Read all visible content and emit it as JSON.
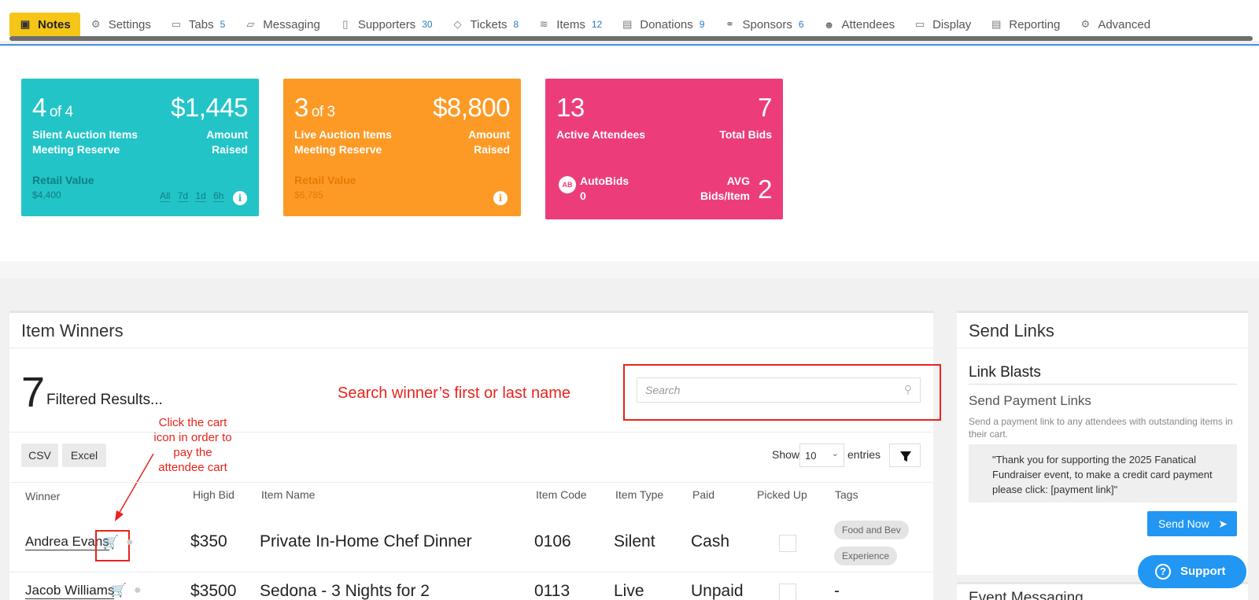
{
  "tabs": [
    {
      "label": "Notes",
      "icon": "notes-icon",
      "glyph": "▣",
      "count": ""
    },
    {
      "label": "Settings",
      "icon": "gear-icon",
      "glyph": "⚙",
      "count": ""
    },
    {
      "label": "Tabs",
      "icon": "folder-icon",
      "glyph": "▭",
      "count": "5"
    },
    {
      "label": "Messaging",
      "icon": "inbox-icon",
      "glyph": "▱",
      "count": ""
    },
    {
      "label": "Supporters",
      "icon": "clipboard-icon",
      "glyph": "▯",
      "count": "30"
    },
    {
      "label": "Tickets",
      "icon": "tag-icon",
      "glyph": "◇",
      "count": "8"
    },
    {
      "label": "Items",
      "icon": "layers-icon",
      "glyph": "≋",
      "count": "12"
    },
    {
      "label": "Donations",
      "icon": "receipt-icon",
      "glyph": "▤",
      "count": "9"
    },
    {
      "label": "Sponsors",
      "icon": "handshake-icon",
      "glyph": "⚭",
      "count": "6"
    },
    {
      "label": "Attendees",
      "icon": "users-icon",
      "glyph": "☻",
      "count": ""
    },
    {
      "label": "Display",
      "icon": "monitor-icon",
      "glyph": "▭",
      "count": ""
    },
    {
      "label": "Reporting",
      "icon": "file-chart-icon",
      "glyph": "▤",
      "count": ""
    },
    {
      "label": "Advanced",
      "icon": "gears-icon",
      "glyph": "⚙",
      "count": ""
    }
  ],
  "cards": {
    "silent": {
      "count": "4",
      "of": "of 4",
      "amount": "$1,445",
      "label1": "Silent Auction Items",
      "label2": "Meeting Reserve",
      "amount_label1": "Amount",
      "amount_label2": "Raised",
      "retail_label": "Retail Value",
      "retail_value": "$4,400",
      "time_filters": [
        "All",
        "7d",
        "1d",
        "6h"
      ],
      "color": "#22c4c8",
      "subcolor": "#0f7f82"
    },
    "live": {
      "count": "3",
      "of": "of 3",
      "amount": "$8,800",
      "label1": "Live Auction Items",
      "label2": "Meeting Reserve",
      "amount_label1": "Amount",
      "amount_label2": "Raised",
      "retail_label": "Retail Value",
      "retail_value": "$6,785",
      "color": "#fd9a26",
      "subcolor": "#e67a00"
    },
    "attendees": {
      "count": "13",
      "count_label": "Active Attendees",
      "bids": "7",
      "bids_label": "Total Bids",
      "autobids_label": "AutoBids",
      "autobids_value": "0",
      "avg_label1": "AVG",
      "avg_label2": "Bids/Item",
      "avg_value": "2",
      "color": "#ec3d7a"
    }
  },
  "winners": {
    "title": "Item Winners",
    "count": "7",
    "count_label": "Filtered Results...",
    "search_placeholder": "Search",
    "csv_label": "CSV",
    "excel_label": "Excel",
    "show_label": "Show",
    "entries_value": "10",
    "entries_label": "entries",
    "columns": [
      "Winner",
      "High Bid",
      "Item Name",
      "Item Code",
      "Item Type",
      "Paid",
      "Picked Up",
      "Tags"
    ],
    "rows": [
      {
        "winner": "Andrea Evans",
        "bid": "$350",
        "item": "Private In-Home Chef Dinner",
        "code": "0106",
        "type": "Silent",
        "paid": "Cash",
        "tags": [
          "Food and Bev",
          "Experience"
        ]
      },
      {
        "winner": "Jacob Williams",
        "bid": "$3500",
        "item": "Sedona - 3 Nights for 2",
        "code": "0113",
        "type": "Live",
        "paid": "Unpaid",
        "tags_text": "-"
      }
    ]
  },
  "annotations": {
    "search_hint": "Search winner’s first or last name",
    "cart_hint": [
      "Click the cart",
      "icon in order to",
      "pay the",
      "attendee cart"
    ],
    "color": "#e8241c"
  },
  "send_links": {
    "title": "Send Links",
    "link_blasts": "Link Blasts",
    "payment_title": "Send Payment Links",
    "description": "Send a payment link to any attendees with outstanding items in their cart.",
    "message": "\"Thank you for supporting the 2025 Fanatical Fundraiser event, to make a credit card payment please click: [payment link]\"",
    "send_button": "Send Now",
    "next_title": "Event Messaging"
  },
  "support_label": "Support"
}
